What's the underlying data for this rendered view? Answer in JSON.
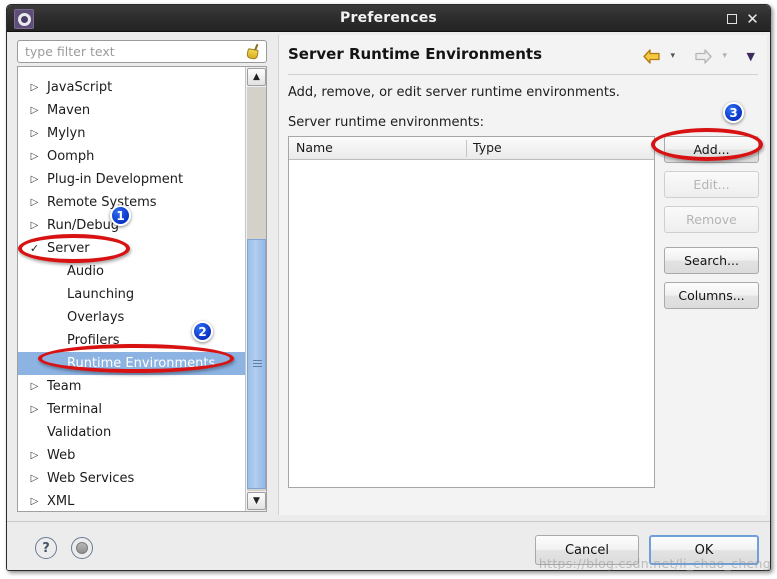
{
  "window": {
    "title": "Preferences",
    "icon": "gear-icon",
    "maximize_label": "□",
    "close_label": "✕"
  },
  "sidebar": {
    "filter": {
      "value": "",
      "placeholder": "type filter text",
      "clear_icon": "broom-icon"
    },
    "items": [
      {
        "label": "JavaScript",
        "level": 0,
        "expandable": true,
        "selected": false
      },
      {
        "label": "Maven",
        "level": 0,
        "expandable": true,
        "selected": false
      },
      {
        "label": "Mylyn",
        "level": 0,
        "expandable": true,
        "selected": false
      },
      {
        "label": "Oomph",
        "level": 0,
        "expandable": true,
        "selected": false
      },
      {
        "label": "Plug-in Development",
        "level": 0,
        "expandable": true,
        "selected": false
      },
      {
        "label": "Remote Systems",
        "level": 0,
        "expandable": true,
        "selected": false
      },
      {
        "label": "Run/Debug",
        "level": 0,
        "expandable": true,
        "selected": false
      },
      {
        "label": "Server",
        "level": 0,
        "expanded": true,
        "selected": false
      },
      {
        "label": "Audio",
        "level": 1,
        "expandable": false,
        "selected": false
      },
      {
        "label": "Launching",
        "level": 1,
        "expandable": false,
        "selected": false
      },
      {
        "label": "Overlays",
        "level": 1,
        "expandable": false,
        "selected": false
      },
      {
        "label": "Profilers",
        "level": 1,
        "expandable": false,
        "selected": false
      },
      {
        "label": "Runtime Environments",
        "level": 1,
        "expandable": false,
        "selected": true
      },
      {
        "label": "Team",
        "level": 0,
        "expandable": true,
        "selected": false
      },
      {
        "label": "Terminal",
        "level": 0,
        "expandable": true,
        "selected": false
      },
      {
        "label": "Validation",
        "level": 0,
        "expandable": false,
        "selected": false
      },
      {
        "label": "Web",
        "level": 0,
        "expandable": true,
        "selected": false
      },
      {
        "label": "Web Services",
        "level": 0,
        "expandable": true,
        "selected": false
      },
      {
        "label": "XML",
        "level": 0,
        "expandable": true,
        "selected": false
      }
    ],
    "scrollbar": {
      "up_arrow": "▲",
      "down_arrow": "▼"
    }
  },
  "page": {
    "title": "Server Runtime Environments",
    "description": "Add, remove, or edit server runtime environments.",
    "list_label": "Server runtime environments:",
    "nav": {
      "back_icon": "back-arrow-icon",
      "back_menu_icon": "chevron-down-icon",
      "forward_icon": "forward-arrow-icon",
      "forward_menu_icon": "chevron-down-icon",
      "more_icon": "view-menu-icon"
    },
    "table": {
      "columns": [
        "Name",
        "Type"
      ],
      "rows": []
    },
    "buttons": [
      {
        "label": "Add...",
        "enabled": true
      },
      {
        "label": "Edit...",
        "enabled": false
      },
      {
        "label": "Remove",
        "enabled": false
      },
      {
        "label": "Search...",
        "enabled": true
      },
      {
        "label": "Columns...",
        "enabled": true
      }
    ]
  },
  "footer": {
    "help_icon": "question-mark-icon",
    "help_label": "?",
    "apply_icon": "apply-icon",
    "cancel_label": "Cancel",
    "ok_label": "OK"
  },
  "annotations": {
    "badges": [
      "1",
      "2",
      "3"
    ],
    "highlight_color": "#d81212",
    "badge_color": "#0a33c7"
  },
  "watermark": "https://blog.csdn.net/li_chao_cheng"
}
